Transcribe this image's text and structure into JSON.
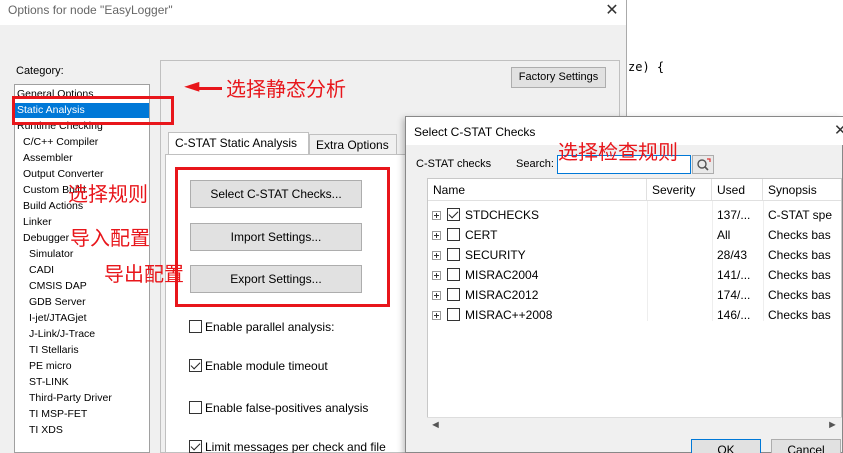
{
  "background_code": {
    "line": "ze) {"
  },
  "options_window": {
    "title": "Options for node \"EasyLogger\"",
    "close_glyph": "✕",
    "category_label": "Category:",
    "categories": [
      {
        "label": "General Options",
        "indent": 0
      },
      {
        "label": "Static Analysis",
        "indent": 0,
        "selected": true
      },
      {
        "label": "Runtime Checking",
        "indent": 0
      },
      {
        "label": "C/C++ Compiler",
        "indent": 1
      },
      {
        "label": "Assembler",
        "indent": 1
      },
      {
        "label": "Output Converter",
        "indent": 1
      },
      {
        "label": "Custom Build",
        "indent": 1
      },
      {
        "label": "Build Actions",
        "indent": 1
      },
      {
        "label": "Linker",
        "indent": 1
      },
      {
        "label": "Debugger",
        "indent": 1
      },
      {
        "label": "Simulator",
        "indent": 2
      },
      {
        "label": "CADI",
        "indent": 2
      },
      {
        "label": "CMSIS DAP",
        "indent": 2
      },
      {
        "label": "GDB Server",
        "indent": 2
      },
      {
        "label": "I-jet/JTAGjet",
        "indent": 2
      },
      {
        "label": "J-Link/J-Trace",
        "indent": 2
      },
      {
        "label": "TI Stellaris",
        "indent": 2
      },
      {
        "label": "PE micro",
        "indent": 2
      },
      {
        "label": "ST-LINK",
        "indent": 2
      },
      {
        "label": "Third-Party Driver",
        "indent": 2
      },
      {
        "label": "TI MSP-FET",
        "indent": 2
      },
      {
        "label": "TI XDS",
        "indent": 2
      }
    ],
    "factory_settings": "Factory Settings",
    "tabs": [
      {
        "label": "C-STAT Static Analysis",
        "active": true
      },
      {
        "label": "Extra Options",
        "active": false
      }
    ],
    "buttons": {
      "select_checks": "Select C-STAT Checks...",
      "import": "Import Settings...",
      "export": "Export Settings..."
    },
    "checkboxes": [
      {
        "label": "Enable parallel analysis:",
        "checked": false
      },
      {
        "label": "Enable module timeout",
        "checked": true
      },
      {
        "label": "Enable false-positives analysis",
        "checked": false
      },
      {
        "label": "Limit messages per check and file",
        "checked": true
      }
    ]
  },
  "annotations": {
    "select_static": "选择静态分析",
    "select_rules": "选择规则",
    "import_config": "导入配置",
    "export_config": "导出配置",
    "select_check_rules": "选择检查规则",
    "arrow_glyph": "◄"
  },
  "checks_dialog": {
    "title": "Select C-STAT Checks",
    "close_glyph": "✕",
    "cstat_label": "C-STAT checks",
    "search_label": "Search:",
    "search_value": "",
    "search_icon": "search-refresh-icon",
    "columns": [
      "Name",
      "Severity",
      "Used",
      "Synopsis"
    ],
    "rows": [
      {
        "name": "STDCHECKS",
        "checked": true,
        "severity": "",
        "used": "137/...",
        "synopsis": "C-STAT spe"
      },
      {
        "name": "CERT",
        "checked": false,
        "severity": "",
        "used": "All",
        "synopsis": "Checks bas"
      },
      {
        "name": "SECURITY",
        "checked": false,
        "severity": "",
        "used": "28/43",
        "synopsis": "Checks bas"
      },
      {
        "name": "MISRAC2004",
        "checked": false,
        "severity": "",
        "used": "141/...",
        "synopsis": "Checks bas"
      },
      {
        "name": "MISRAC2012",
        "checked": false,
        "severity": "",
        "used": "174/...",
        "synopsis": "Checks bas"
      },
      {
        "name": "MISRAC++2008",
        "checked": false,
        "severity": "",
        "used": "146/...",
        "synopsis": "Checks bas"
      }
    ],
    "scroll_left": "◄",
    "scroll_right": "►",
    "ok": "OK",
    "cancel": "Cancel"
  },
  "colors": {
    "annotation_red": "#e8161b",
    "selection_blue": "#0078d7"
  }
}
